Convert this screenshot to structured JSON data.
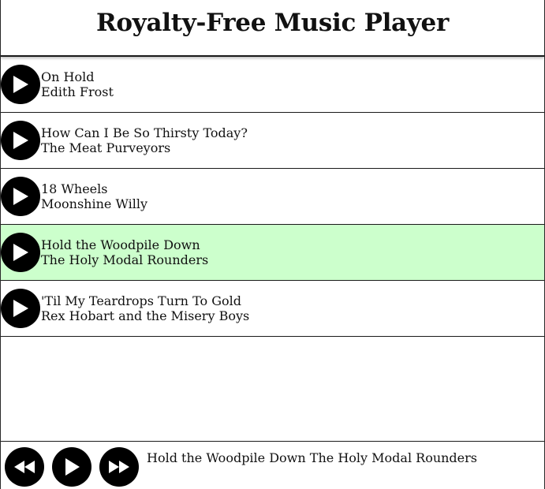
{
  "header": {
    "title": "Royalty-Free Music Player"
  },
  "tracks": [
    {
      "title": "On Hold",
      "artist": "Edith Frost",
      "selected": false
    },
    {
      "title": "How Can I Be So Thirsty Today?",
      "artist": "The Meat Purveyors",
      "selected": false
    },
    {
      "title": "18 Wheels",
      "artist": "Moonshine Willy",
      "selected": false
    },
    {
      "title": "Hold the Woodpile Down",
      "artist": "The Holy Modal Rounders",
      "selected": true
    },
    {
      "title": "'Til My Teardrops Turn To Gold",
      "artist": "Rex Hobart and the Misery Boys",
      "selected": false
    }
  ],
  "player": {
    "now_playing_title": "Hold the Woodpile Down",
    "now_playing_artist": "The Holy Modal Rounders"
  },
  "colors": {
    "selected_row": "#ccffcc",
    "button_fill": "#000000",
    "icon_fill": "#ffffff"
  },
  "icons": {
    "track_button": "play-icon",
    "previous": "rewind-icon",
    "play": "play-icon",
    "next": "fast-forward-icon"
  }
}
